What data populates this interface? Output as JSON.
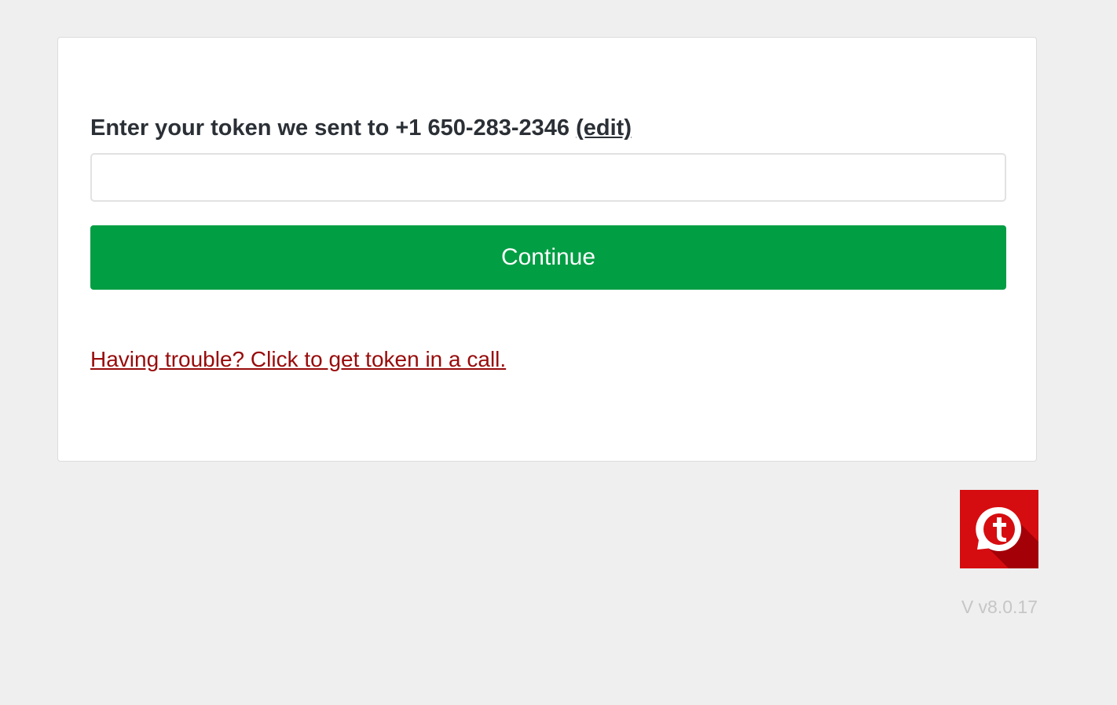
{
  "form": {
    "prompt_text": "Enter your token we sent to +1 650-283-2346",
    "edit_label": "(edit)",
    "token_value": "",
    "token_placeholder": "",
    "continue_label": "Continue",
    "trouble_link": "Having trouble? Click to get token in a call."
  },
  "footer": {
    "logo_icon": "twilio-t-logo-icon",
    "version": "V v8.0.17"
  },
  "colors": {
    "background": "#efefef",
    "accent_green": "#029e44",
    "link_red": "#980b0b",
    "logo_red": "#d60d10",
    "text_dark": "#2b3036"
  }
}
